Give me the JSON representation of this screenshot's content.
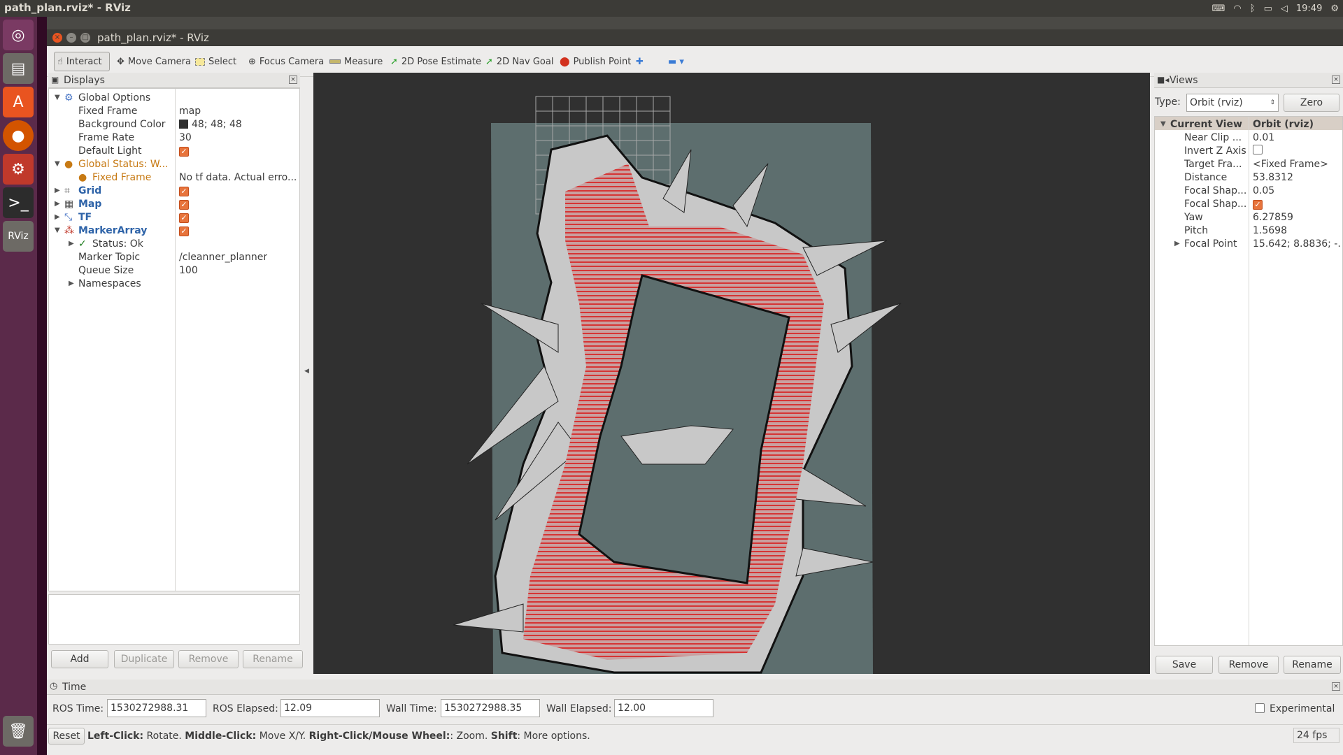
{
  "desktop": {
    "top_title": "path_plan.rviz* - RViz",
    "clock": "19:49"
  },
  "window": {
    "title": "path_plan.rviz* - RViz"
  },
  "toolbar": {
    "interact": "Interact",
    "move_camera": "Move Camera",
    "select": "Select",
    "focus_camera": "Focus Camera",
    "measure": "Measure",
    "pose_estimate": "2D Pose Estimate",
    "nav_goal": "2D Nav Goal",
    "publish_point": "Publish Point"
  },
  "displays": {
    "title": "Displays",
    "global_options": "Global Options",
    "fixed_frame_key": "Fixed Frame",
    "fixed_frame_val": "map",
    "bg_color_key": "Background Color",
    "bg_color_val": "48; 48; 48",
    "frame_rate_key": "Frame Rate",
    "frame_rate_val": "30",
    "default_light_key": "Default Light",
    "global_status": "Global Status: W...",
    "fixed_frame_warn_key": "Fixed Frame",
    "fixed_frame_warn_val": "No tf data.  Actual erro...",
    "grid": "Grid",
    "map": "Map",
    "tf": "TF",
    "marker_array": "MarkerArray",
    "status_ok": "Status: Ok",
    "marker_topic_key": "Marker Topic",
    "marker_topic_val": "/cleanner_planner",
    "queue_size_key": "Queue Size",
    "queue_size_val": "100",
    "namespaces": "Namespaces",
    "add": "Add",
    "duplicate": "Duplicate",
    "remove": "Remove",
    "rename": "Rename"
  },
  "views": {
    "title": "Views",
    "type_label": "Type:",
    "type_value": "Orbit (rviz)",
    "zero": "Zero",
    "current_view": "Current View",
    "current_view_val": "Orbit (rviz)",
    "near_clip": "Near Clip ...",
    "near_clip_val": "0.01",
    "invert_z": "Invert Z Axis",
    "target_frame": "Target Fra...",
    "target_frame_val": "<Fixed Frame>",
    "distance": "Distance",
    "distance_val": "53.8312",
    "focal_shape1": "Focal Shap...",
    "focal_shape1_val": "0.05",
    "focal_shape2": "Focal Shap...",
    "yaw": "Yaw",
    "yaw_val": "6.27859",
    "pitch": "Pitch",
    "pitch_val": "1.5698",
    "focal_point": "Focal Point",
    "focal_point_val": "15.642; 8.8836; -...",
    "save": "Save",
    "remove": "Remove",
    "rename": "Rename"
  },
  "time": {
    "title": "Time",
    "ros_time_label": "ROS Time:",
    "ros_time": "1530272988.31",
    "ros_elapsed_label": "ROS Elapsed:",
    "ros_elapsed": "12.09",
    "wall_time_label": "Wall Time:",
    "wall_time": "1530272988.35",
    "wall_elapsed_label": "Wall Elapsed:",
    "wall_elapsed": "12.00",
    "experimental": "Experimental"
  },
  "status": {
    "reset": "Reset",
    "left_click": "Left-Click:",
    "left_click_desc": " Rotate. ",
    "middle_click": "Middle-Click:",
    "middle_click_desc": " Move X/Y. ",
    "right_click": "Right-Click/Mouse Wheel:",
    "right_click_desc": ": Zoom. ",
    "shift": "Shift",
    "shift_desc": ": More options.",
    "fps": "24 fps"
  },
  "colors": {
    "bg": "#303030",
    "map_free": "#c8c8c8",
    "map_unknown": "#5a6b6b",
    "path": "#d43a3a",
    "accent": "#e7743c"
  }
}
